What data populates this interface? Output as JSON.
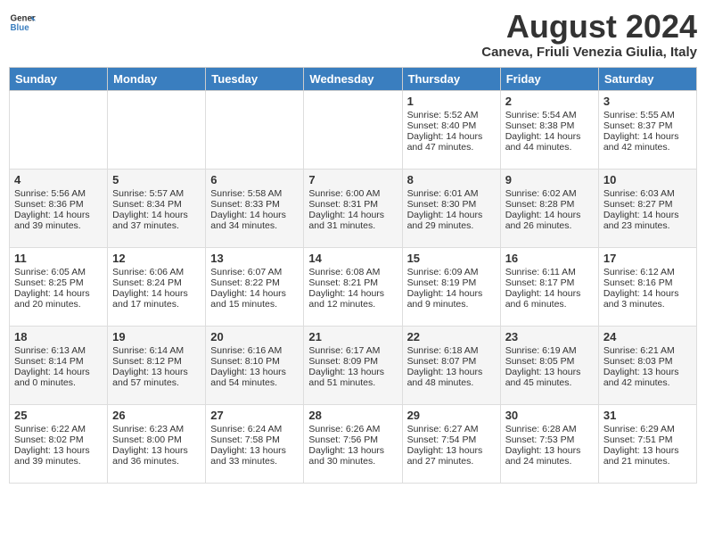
{
  "header": {
    "logo_general": "General",
    "logo_blue": "Blue",
    "month_year": "August 2024",
    "location": "Caneva, Friuli Venezia Giulia, Italy"
  },
  "days_of_week": [
    "Sunday",
    "Monday",
    "Tuesday",
    "Wednesday",
    "Thursday",
    "Friday",
    "Saturday"
  ],
  "weeks": [
    [
      {
        "day": "",
        "content": ""
      },
      {
        "day": "",
        "content": ""
      },
      {
        "day": "",
        "content": ""
      },
      {
        "day": "",
        "content": ""
      },
      {
        "day": "1",
        "content": "Sunrise: 5:52 AM\nSunset: 8:40 PM\nDaylight: 14 hours and 47 minutes."
      },
      {
        "day": "2",
        "content": "Sunrise: 5:54 AM\nSunset: 8:38 PM\nDaylight: 14 hours and 44 minutes."
      },
      {
        "day": "3",
        "content": "Sunrise: 5:55 AM\nSunset: 8:37 PM\nDaylight: 14 hours and 42 minutes."
      }
    ],
    [
      {
        "day": "4",
        "content": "Sunrise: 5:56 AM\nSunset: 8:36 PM\nDaylight: 14 hours and 39 minutes."
      },
      {
        "day": "5",
        "content": "Sunrise: 5:57 AM\nSunset: 8:34 PM\nDaylight: 14 hours and 37 minutes."
      },
      {
        "day": "6",
        "content": "Sunrise: 5:58 AM\nSunset: 8:33 PM\nDaylight: 14 hours and 34 minutes."
      },
      {
        "day": "7",
        "content": "Sunrise: 6:00 AM\nSunset: 8:31 PM\nDaylight: 14 hours and 31 minutes."
      },
      {
        "day": "8",
        "content": "Sunrise: 6:01 AM\nSunset: 8:30 PM\nDaylight: 14 hours and 29 minutes."
      },
      {
        "day": "9",
        "content": "Sunrise: 6:02 AM\nSunset: 8:28 PM\nDaylight: 14 hours and 26 minutes."
      },
      {
        "day": "10",
        "content": "Sunrise: 6:03 AM\nSunset: 8:27 PM\nDaylight: 14 hours and 23 minutes."
      }
    ],
    [
      {
        "day": "11",
        "content": "Sunrise: 6:05 AM\nSunset: 8:25 PM\nDaylight: 14 hours and 20 minutes."
      },
      {
        "day": "12",
        "content": "Sunrise: 6:06 AM\nSunset: 8:24 PM\nDaylight: 14 hours and 17 minutes."
      },
      {
        "day": "13",
        "content": "Sunrise: 6:07 AM\nSunset: 8:22 PM\nDaylight: 14 hours and 15 minutes."
      },
      {
        "day": "14",
        "content": "Sunrise: 6:08 AM\nSunset: 8:21 PM\nDaylight: 14 hours and 12 minutes."
      },
      {
        "day": "15",
        "content": "Sunrise: 6:09 AM\nSunset: 8:19 PM\nDaylight: 14 hours and 9 minutes."
      },
      {
        "day": "16",
        "content": "Sunrise: 6:11 AM\nSunset: 8:17 PM\nDaylight: 14 hours and 6 minutes."
      },
      {
        "day": "17",
        "content": "Sunrise: 6:12 AM\nSunset: 8:16 PM\nDaylight: 14 hours and 3 minutes."
      }
    ],
    [
      {
        "day": "18",
        "content": "Sunrise: 6:13 AM\nSunset: 8:14 PM\nDaylight: 14 hours and 0 minutes."
      },
      {
        "day": "19",
        "content": "Sunrise: 6:14 AM\nSunset: 8:12 PM\nDaylight: 13 hours and 57 minutes."
      },
      {
        "day": "20",
        "content": "Sunrise: 6:16 AM\nSunset: 8:10 PM\nDaylight: 13 hours and 54 minutes."
      },
      {
        "day": "21",
        "content": "Sunrise: 6:17 AM\nSunset: 8:09 PM\nDaylight: 13 hours and 51 minutes."
      },
      {
        "day": "22",
        "content": "Sunrise: 6:18 AM\nSunset: 8:07 PM\nDaylight: 13 hours and 48 minutes."
      },
      {
        "day": "23",
        "content": "Sunrise: 6:19 AM\nSunset: 8:05 PM\nDaylight: 13 hours and 45 minutes."
      },
      {
        "day": "24",
        "content": "Sunrise: 6:21 AM\nSunset: 8:03 PM\nDaylight: 13 hours and 42 minutes."
      }
    ],
    [
      {
        "day": "25",
        "content": "Sunrise: 6:22 AM\nSunset: 8:02 PM\nDaylight: 13 hours and 39 minutes."
      },
      {
        "day": "26",
        "content": "Sunrise: 6:23 AM\nSunset: 8:00 PM\nDaylight: 13 hours and 36 minutes."
      },
      {
        "day": "27",
        "content": "Sunrise: 6:24 AM\nSunset: 7:58 PM\nDaylight: 13 hours and 33 minutes."
      },
      {
        "day": "28",
        "content": "Sunrise: 6:26 AM\nSunset: 7:56 PM\nDaylight: 13 hours and 30 minutes."
      },
      {
        "day": "29",
        "content": "Sunrise: 6:27 AM\nSunset: 7:54 PM\nDaylight: 13 hours and 27 minutes."
      },
      {
        "day": "30",
        "content": "Sunrise: 6:28 AM\nSunset: 7:53 PM\nDaylight: 13 hours and 24 minutes."
      },
      {
        "day": "31",
        "content": "Sunrise: 6:29 AM\nSunset: 7:51 PM\nDaylight: 13 hours and 21 minutes."
      }
    ]
  ]
}
